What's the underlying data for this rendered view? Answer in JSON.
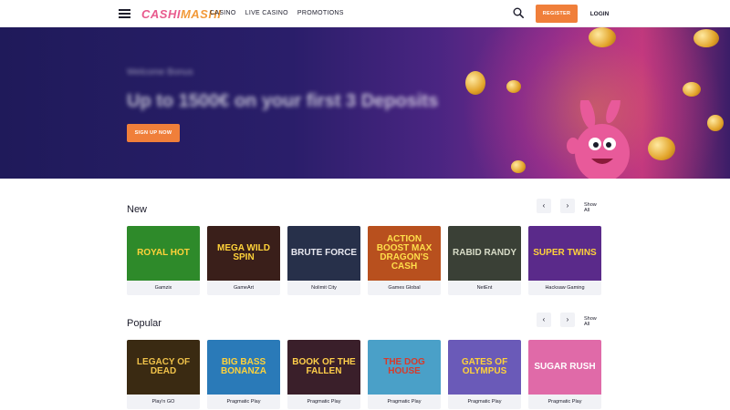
{
  "header": {
    "logo_part1": "CASHI",
    "logo_part2": "MASHI",
    "nav": [
      "CASINO",
      "LIVE CASINO",
      "PROMOTIONS"
    ],
    "register_label": "REGISTER",
    "login_label": "LOGIN"
  },
  "hero": {
    "eyebrow": "Welcome Bonus",
    "title": "Up to 1500€ on your first 3 Deposits",
    "cta_label": "SIGN UP NOW"
  },
  "sections": [
    {
      "title": "New",
      "show_all": "Show All",
      "games": [
        {
          "title": "ROYAL HOT",
          "provider": "Gamzix",
          "bg": "#2e8a2a",
          "fg": "#ffd23a"
        },
        {
          "title": "MEGA WILD SPIN",
          "provider": "GameArt",
          "bg": "#3a1f1a",
          "fg": "#ffd23a"
        },
        {
          "title": "BRUTE FORCE",
          "provider": "Nolimit City",
          "bg": "#27304a",
          "fg": "#e8e8f0"
        },
        {
          "title": "ACTION BOOST MAX DRAGON'S CASH",
          "provider": "Games Global",
          "bg": "#b8501e",
          "fg": "#ffde4a"
        },
        {
          "title": "RABID RANDY",
          "provider": "NetEnt",
          "bg": "#3a4036",
          "fg": "#d8dcc8"
        },
        {
          "title": "SUPER TWINS",
          "provider": "Hacksaw Gaming",
          "bg": "#5a2a8a",
          "fg": "#ffd23a"
        }
      ]
    },
    {
      "title": "Popular",
      "show_all": "Show All",
      "games": [
        {
          "title": "LEGACY OF DEAD",
          "provider": "Play'n GO",
          "bg": "#3a2a12",
          "fg": "#f0c24a"
        },
        {
          "title": "BIG BASS BONANZA",
          "provider": "Pragmatic Play",
          "bg": "#2a7ab8",
          "fg": "#ffd23a"
        },
        {
          "title": "BOOK OF THE FALLEN",
          "provider": "Pragmatic Play",
          "bg": "#3a1f2a",
          "fg": "#ffcf4a"
        },
        {
          "title": "THE DOG HOUSE",
          "provider": "Pragmatic Play",
          "bg": "#4aa0c8",
          "fg": "#d83a2a"
        },
        {
          "title": "GATES OF OLYMPUS",
          "provider": "Pragmatic Play",
          "bg": "#6a5ab8",
          "fg": "#ffd23a"
        },
        {
          "title": "SUGAR RUSH",
          "provider": "Pragmatic Play",
          "bg": "#e06aa8",
          "fg": "#ffffff"
        }
      ]
    }
  ],
  "colors": {
    "accent": "#f07f3a",
    "brand_pink": "#e85a8d",
    "text": "#1c1c2b",
    "card_bg": "#f1f2f6"
  },
  "icons": {
    "menu": "hamburger-icon",
    "search": "search-icon",
    "prev": "chevron-left-icon",
    "next": "chevron-right-icon"
  }
}
